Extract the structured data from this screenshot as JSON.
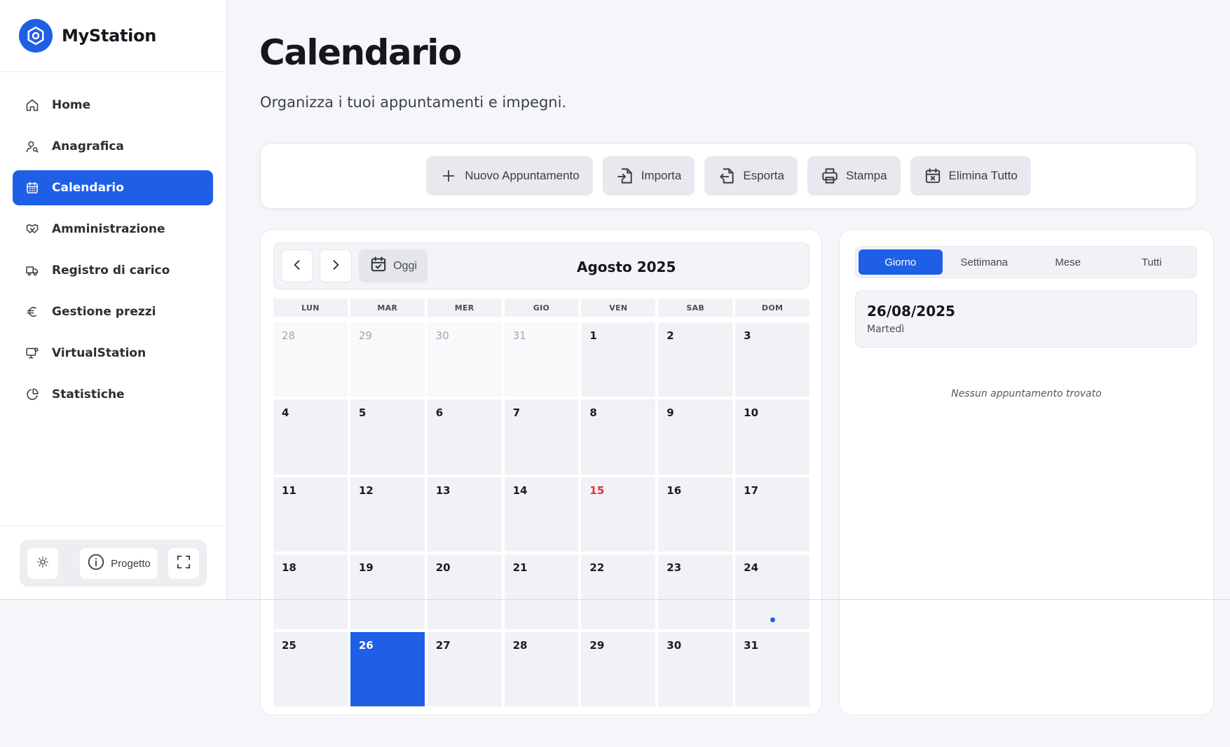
{
  "app": {
    "name": "MyStation"
  },
  "sidebar": {
    "items": [
      {
        "id": "home",
        "label": "Home",
        "icon": "home-icon",
        "active": false
      },
      {
        "id": "anagrafica",
        "label": "Anagrafica",
        "icon": "user-search-icon",
        "active": false
      },
      {
        "id": "calendario",
        "label": "Calendario",
        "icon": "calendar-icon",
        "active": true
      },
      {
        "id": "amministrazione",
        "label": "Amministrazione",
        "icon": "handshake-icon",
        "active": false
      },
      {
        "id": "registro",
        "label": "Registro di carico",
        "icon": "truck-icon",
        "active": false
      },
      {
        "id": "prezzi",
        "label": "Gestione prezzi",
        "icon": "euro-icon",
        "active": false
      },
      {
        "id": "virtualstation",
        "label": "VirtualStation",
        "icon": "monitor-icon",
        "active": false
      },
      {
        "id": "statistiche",
        "label": "Statistiche",
        "icon": "pie-chart-icon",
        "active": false
      }
    ],
    "footer": {
      "project_label": "Progetto"
    }
  },
  "page": {
    "title": "Calendario",
    "subtitle": "Organizza i tuoi appuntamenti e impegni."
  },
  "toolbar": {
    "new_label": "Nuovo Appuntamento",
    "import_label": "Importa",
    "export_label": "Esporta",
    "print_label": "Stampa",
    "delete_all_label": "Elimina Tutto"
  },
  "calendar": {
    "month_label": "Agosto 2025",
    "today_label": "Oggi",
    "weekdays": [
      "LUN",
      "MAR",
      "MER",
      "GIO",
      "VEN",
      "SAB",
      "DOM"
    ],
    "days": [
      {
        "n": "28",
        "other": true
      },
      {
        "n": "29",
        "other": true
      },
      {
        "n": "30",
        "other": true
      },
      {
        "n": "31",
        "other": true
      },
      {
        "n": "1"
      },
      {
        "n": "2"
      },
      {
        "n": "3"
      },
      {
        "n": "4"
      },
      {
        "n": "5"
      },
      {
        "n": "6"
      },
      {
        "n": "7"
      },
      {
        "n": "8"
      },
      {
        "n": "9"
      },
      {
        "n": "10"
      },
      {
        "n": "11"
      },
      {
        "n": "12"
      },
      {
        "n": "13"
      },
      {
        "n": "14"
      },
      {
        "n": "15",
        "holiday": true
      },
      {
        "n": "16"
      },
      {
        "n": "17"
      },
      {
        "n": "18"
      },
      {
        "n": "19"
      },
      {
        "n": "20"
      },
      {
        "n": "21"
      },
      {
        "n": "22"
      },
      {
        "n": "23"
      },
      {
        "n": "24",
        "event": true
      },
      {
        "n": "25"
      },
      {
        "n": "26",
        "selected": true
      },
      {
        "n": "27"
      },
      {
        "n": "28"
      },
      {
        "n": "29"
      },
      {
        "n": "30"
      },
      {
        "n": "31"
      }
    ]
  },
  "panel": {
    "tabs": [
      {
        "label": "Giorno",
        "active": true
      },
      {
        "label": "Settimana",
        "active": false
      },
      {
        "label": "Mese",
        "active": false
      },
      {
        "label": "Tutti",
        "active": false
      }
    ],
    "selected_date": "26/08/2025",
    "selected_weekday": "Martedì",
    "empty_text": "Nessun appuntamento trovato"
  },
  "colors": {
    "accent": "#1f5fe6",
    "holiday": "#e0303a"
  }
}
